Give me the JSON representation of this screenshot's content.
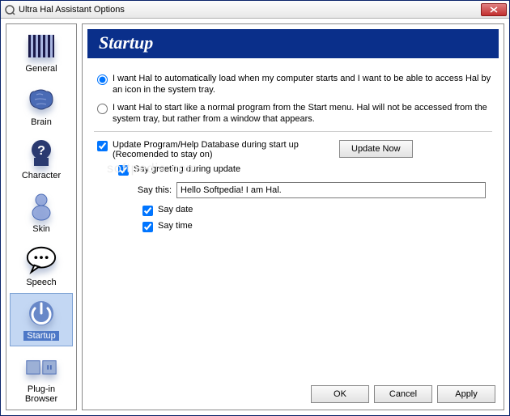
{
  "window": {
    "title": "Ultra Hal Assistant Options"
  },
  "sidebar": {
    "items": [
      {
        "label": "General"
      },
      {
        "label": "Brain"
      },
      {
        "label": "Character"
      },
      {
        "label": "Skin"
      },
      {
        "label": "Speech"
      },
      {
        "label": "Startup"
      },
      {
        "label": "Plug-in Browser"
      }
    ],
    "selected_index": 5
  },
  "main": {
    "heading": "Startup",
    "radio_auto": "I want Hal to automatically load when my computer starts and I want to be able to access Hal by an icon in the system tray.",
    "radio_normal": "I want Hal to start like a normal program from the Start menu. Hal will not be accessed from the system tray, but rather from a window that appears.",
    "update_label": "Update Program/Help Database during start up (Recomended to stay on)",
    "update_now": "Update Now",
    "say_greeting": "Say greeting during update",
    "say_this_label": "Say this:",
    "say_this_value": "Hello Softpedia! I am Hal.",
    "say_date": "Say date",
    "say_time": "Say time"
  },
  "buttons": {
    "ok": "OK",
    "cancel": "Cancel",
    "apply": "Apply"
  },
  "watermark": "softpedia.com"
}
